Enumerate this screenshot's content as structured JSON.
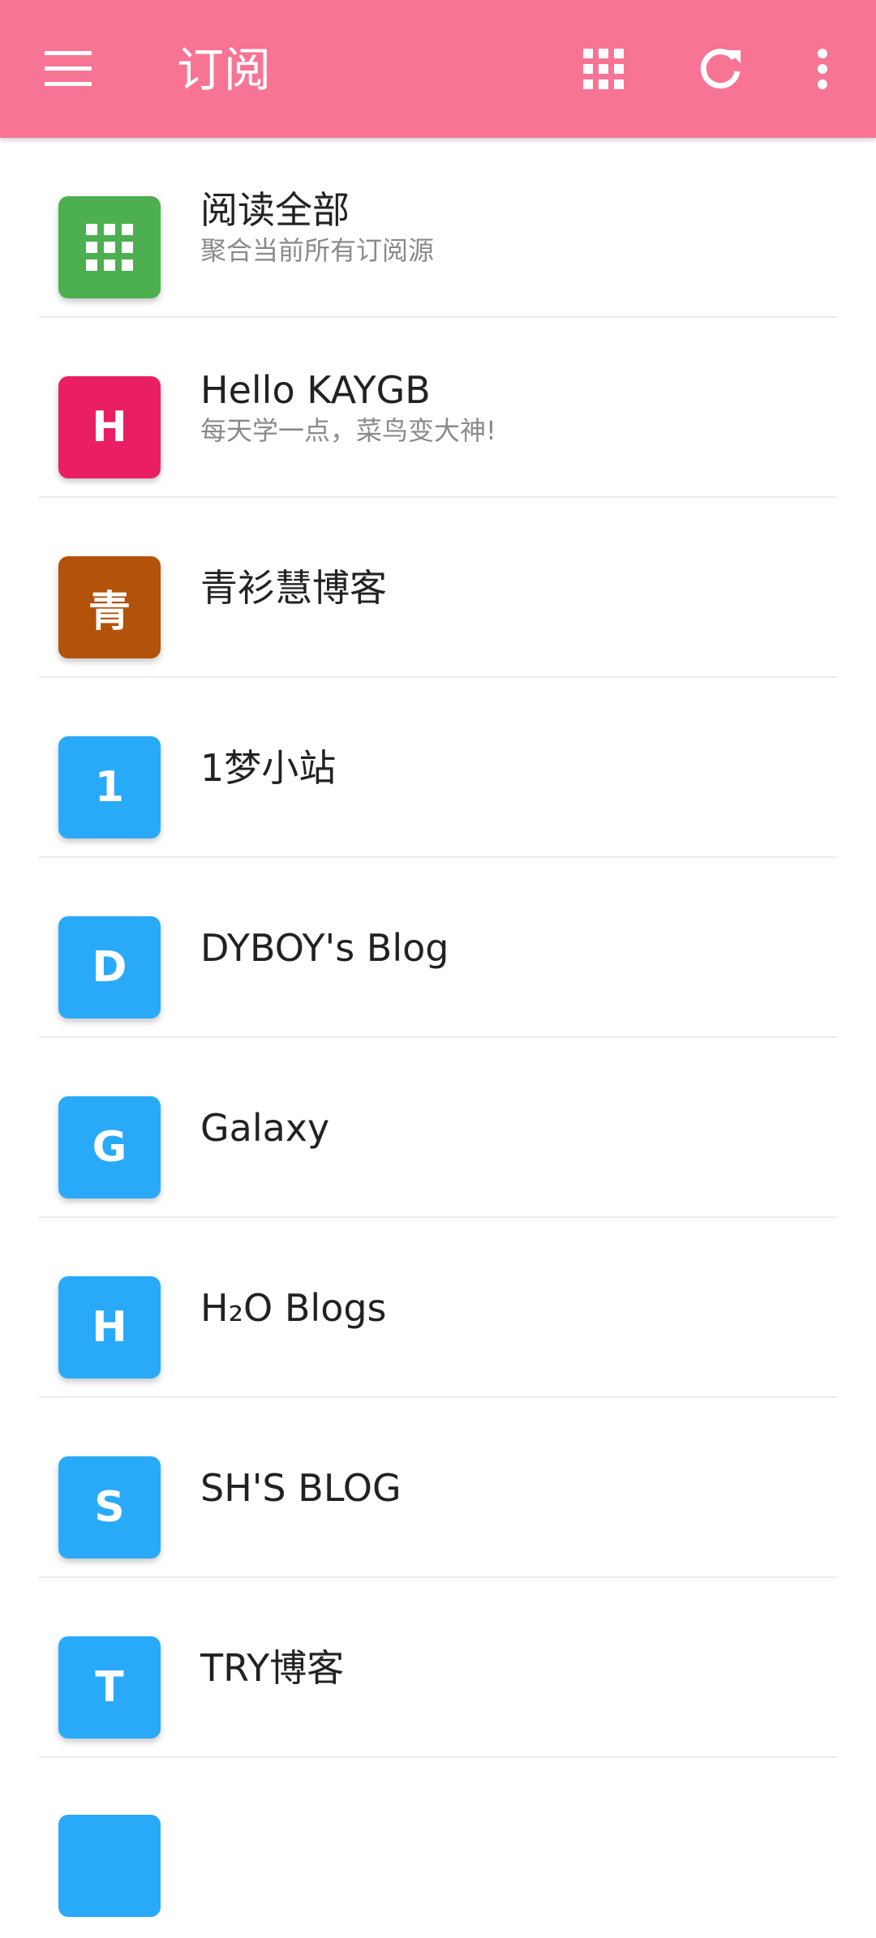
{
  "appbar": {
    "title": "订阅",
    "icons": [
      "menu-icon",
      "grid-icon",
      "refresh-icon",
      "more-vert-icon"
    ]
  },
  "colors": {
    "appbar": "#f87494",
    "grid_avatar": "#4caf50",
    "hello_avatar": "#e91e63",
    "qing_avatar": "#b3520a",
    "blue_avatar": "#29aaf8"
  },
  "feeds": [
    {
      "letter": "",
      "icon": "grid-icon",
      "title": "阅读全部",
      "subtitle": "聚合当前所有订阅源"
    },
    {
      "letter": "H",
      "title": "Hello KAYGB",
      "subtitle": "每天学一点，菜鸟变大神!"
    },
    {
      "letter": "青",
      "title": "青衫慧博客",
      "subtitle": ""
    },
    {
      "letter": "1",
      "title": "1梦小站",
      "subtitle": ""
    },
    {
      "letter": "D",
      "title": "DYBOY's Blog",
      "subtitle": ""
    },
    {
      "letter": "G",
      "title": "Galaxy",
      "subtitle": ""
    },
    {
      "letter": "H",
      "title": "H₂O Blogs",
      "subtitle": ""
    },
    {
      "letter": "S",
      "title": "SH'S BLOG",
      "subtitle": ""
    },
    {
      "letter": "T",
      "title": "TRY博客",
      "subtitle": ""
    }
  ]
}
